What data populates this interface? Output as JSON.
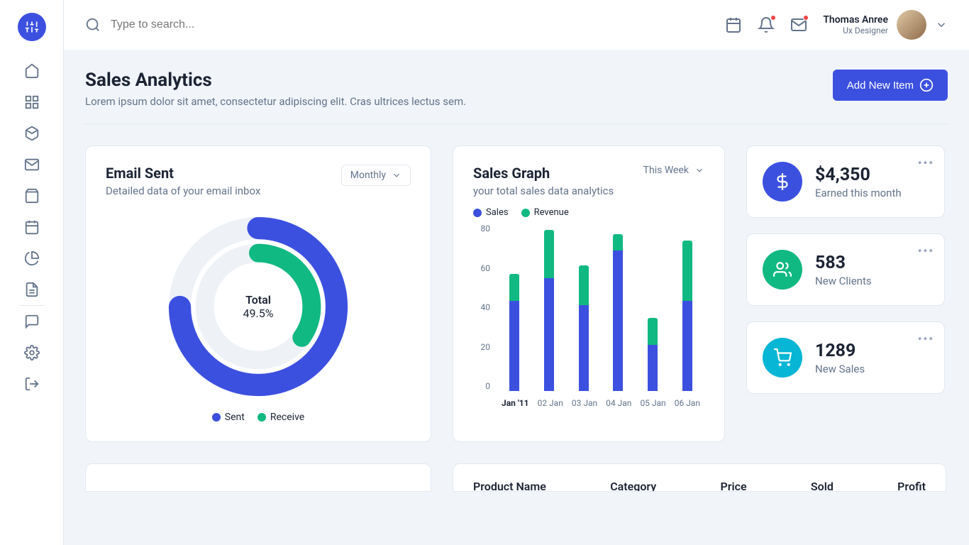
{
  "colors": {
    "primary": "#3c50e0",
    "green": "#10b981",
    "cyan": "#06b6d4",
    "danger": "#ef4444"
  },
  "header": {
    "search_placeholder": "Type to search...",
    "user": {
      "name": "Thomas Anree",
      "role": "Ux Designer"
    }
  },
  "page": {
    "title": "Sales Analytics",
    "subtitle": "Lorem ipsum dolor sit amet, consectetur adipiscing elit. Cras ultrices lectus sem.",
    "cta": "Add New Item"
  },
  "email_card": {
    "title": "Email Sent",
    "subtitle": "Detailed data of your email inbox",
    "dropdown": "Monthly",
    "center_label": "Total",
    "center_value": "49.5%",
    "legend": [
      {
        "label": "Sent",
        "color": "#3c50e0"
      },
      {
        "label": "Receive",
        "color": "#10b981"
      }
    ]
  },
  "sales_card": {
    "title": "Sales Graph",
    "subtitle": "your total sales data analytics",
    "dropdown": "This Week",
    "legend": [
      {
        "label": "Sales",
        "color": "#3c50e0"
      },
      {
        "label": "Revenue",
        "color": "#10b981"
      }
    ]
  },
  "stats": [
    {
      "icon": "dollar",
      "bg": "bg-blue",
      "value": "$4,350",
      "label": "Earned this month"
    },
    {
      "icon": "users",
      "bg": "bg-green",
      "value": "583",
      "label": "New Clients"
    },
    {
      "icon": "cart",
      "bg": "bg-cyan",
      "value": "1289",
      "label": "New Sales"
    }
  ],
  "table": {
    "heading": "Product Name",
    "cols": [
      "Category",
      "Price",
      "Sold",
      "Profit"
    ]
  },
  "chart_data": [
    {
      "type": "pie",
      "title": "Email Sent",
      "series": [
        {
          "name": "Sent",
          "value": 75,
          "color": "#3c50e0"
        },
        {
          "name": "Receive",
          "value": 35,
          "color": "#10b981"
        }
      ],
      "center": {
        "label": "Total",
        "value": "49.5%"
      },
      "note": "Two concentric arcs; outer ring = Sent ≈75% sweep, inner ring = Receive ≈35% sweep."
    },
    {
      "type": "bar",
      "title": "Sales Graph",
      "stacked": true,
      "categories": [
        "Jan '11",
        "02 Jan",
        "03 Jan",
        "04 Jan",
        "05 Jan",
        "06 Jan"
      ],
      "series": [
        {
          "name": "Sales",
          "color": "#3c50e0",
          "values": [
            43,
            54,
            41,
            67,
            22,
            43
          ]
        },
        {
          "name": "Revenue",
          "color": "#10b981",
          "values": [
            13,
            23,
            19,
            8,
            13,
            29
          ]
        }
      ],
      "ylim": [
        0,
        80
      ],
      "yticks": [
        0,
        20,
        40,
        60,
        80
      ],
      "xlabel": "",
      "ylabel": ""
    }
  ]
}
